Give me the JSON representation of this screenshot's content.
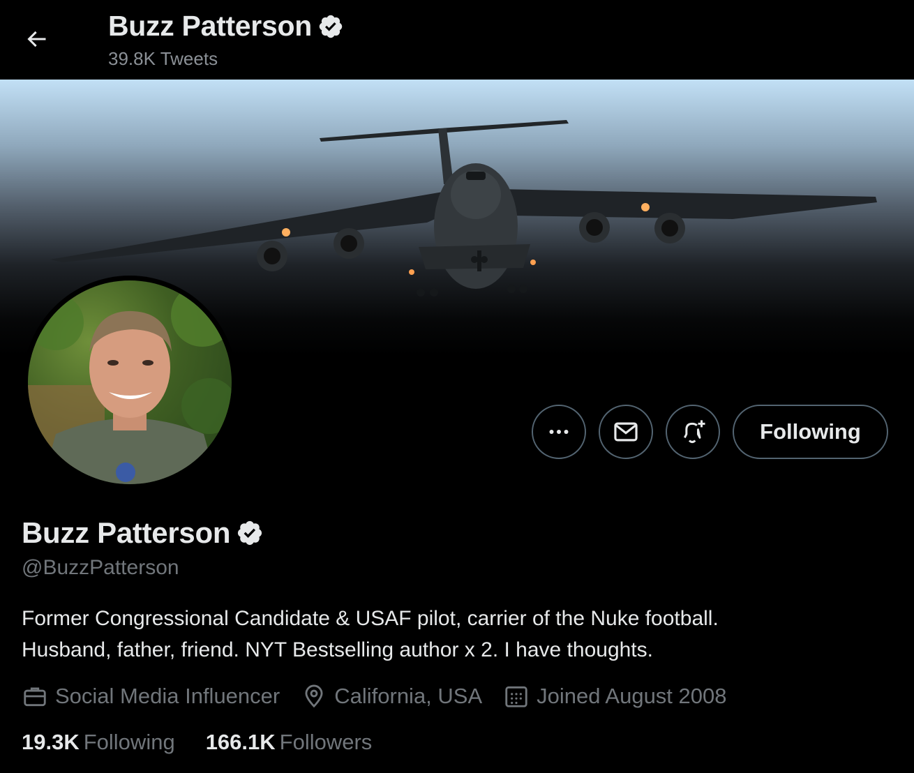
{
  "header": {
    "name": "Buzz Patterson",
    "tweets": "39.8K Tweets"
  },
  "profile": {
    "name": "Buzz Patterson",
    "handle": "@BuzzPatterson",
    "bio_line1": "Former Congressional Candidate & USAF pilot, carrier of the Nuke football.",
    "bio_line2": "Husband, father, friend. NYT Bestselling author x 2. I have thoughts.",
    "profession": "Social Media Influencer",
    "location": "California, USA",
    "joined": "Joined August 2008"
  },
  "actions": {
    "following_label": "Following"
  },
  "stats": {
    "following_count": "19.3K",
    "following_label": "Following",
    "followers_count": "166.1K",
    "followers_label": "Followers"
  },
  "icons": {
    "back": "arrow-left-icon",
    "verified": "verified-badge-icon",
    "more": "more-icon",
    "message": "envelope-icon",
    "notify": "bell-plus-icon",
    "profession": "briefcase-icon",
    "location": "location-pin-icon",
    "joined": "calendar-icon"
  },
  "colors": {
    "background": "#000000",
    "text": "#e7e9ea",
    "secondary": "#71767b",
    "border": "#536471"
  }
}
